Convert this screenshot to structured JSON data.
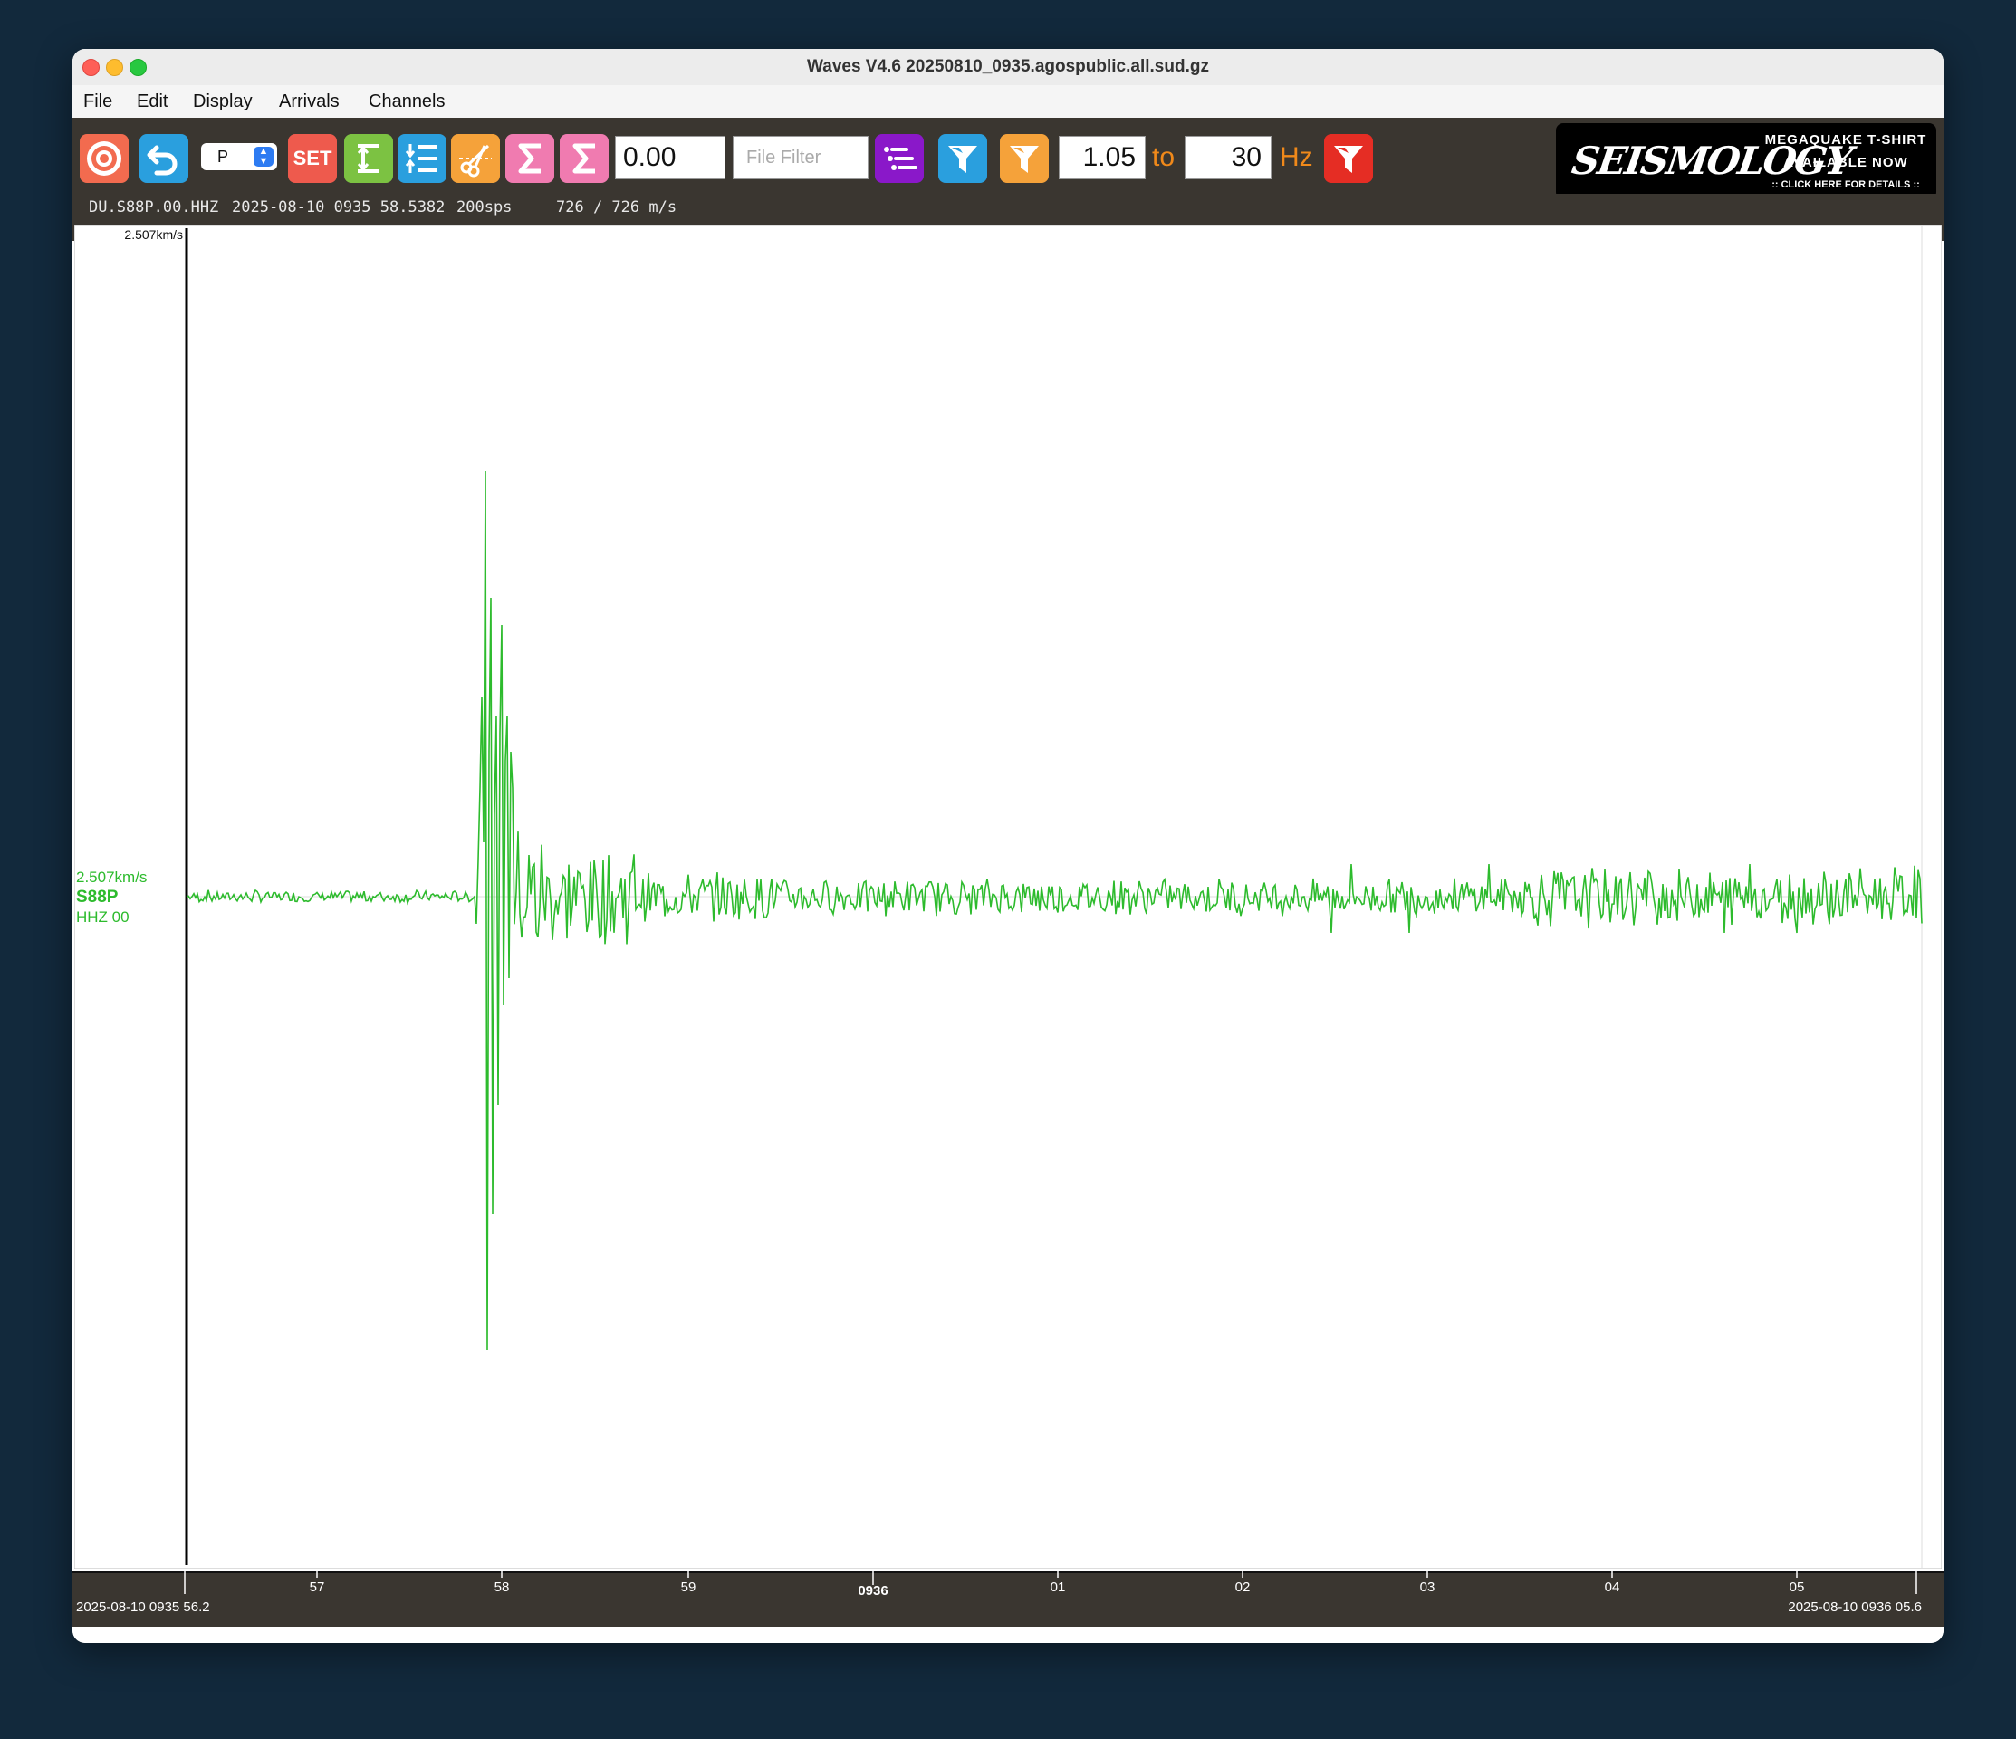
{
  "window": {
    "title": "Waves V4.6 20250810_0935.agospublic.all.sud.gz"
  },
  "menu": [
    "File",
    "Edit",
    "Display",
    "Arrivals",
    "Channels"
  ],
  "toolbar": {
    "target_icon": "target-icon",
    "undo_icon": "undo-icon",
    "phase_select": "P",
    "set_label": "SET",
    "offset_value": "0.00",
    "file_filter_placeholder": "File Filter",
    "filter_low": "1.05",
    "to_label": "to",
    "filter_high": "30",
    "hz_label": "Hz",
    "colors": {
      "target": "#f26b4f",
      "undo": "#2a9fde",
      "set": "#ee5a4d",
      "green": "#7cc242",
      "blue": "#2a9fde",
      "orange": "#f5a23a",
      "pink": "#f07bb0",
      "purple": "#8a18c9",
      "red": "#e52d24"
    }
  },
  "ad": {
    "logo_text": "SEISMOLOGY",
    "line1": "MEGAQUAKE T-SHIRT",
    "line2": "AVAILABLE NOW",
    "line3": ":: CLICK HERE FOR DETAILS ::"
  },
  "info": {
    "channel": "DU.S88P.00.HHZ",
    "timestamp": "2025-08-10 0935 58.5382",
    "sps": "200sps",
    "velocity": "726 / 726 m/s"
  },
  "trace": {
    "scale_top": "2.507km/s",
    "scale_left": "2.507km/s",
    "station": "S88P",
    "channel": "HHZ 00",
    "color": "#2dbb2d"
  },
  "time_axis": {
    "start_label": "2025-08-10 0935 56.2",
    "end_label": "2025-08-10 0936 05.6",
    "ticks": [
      "57",
      "58",
      "59",
      "0936",
      "01",
      "02",
      "03",
      "04",
      "05"
    ]
  }
}
